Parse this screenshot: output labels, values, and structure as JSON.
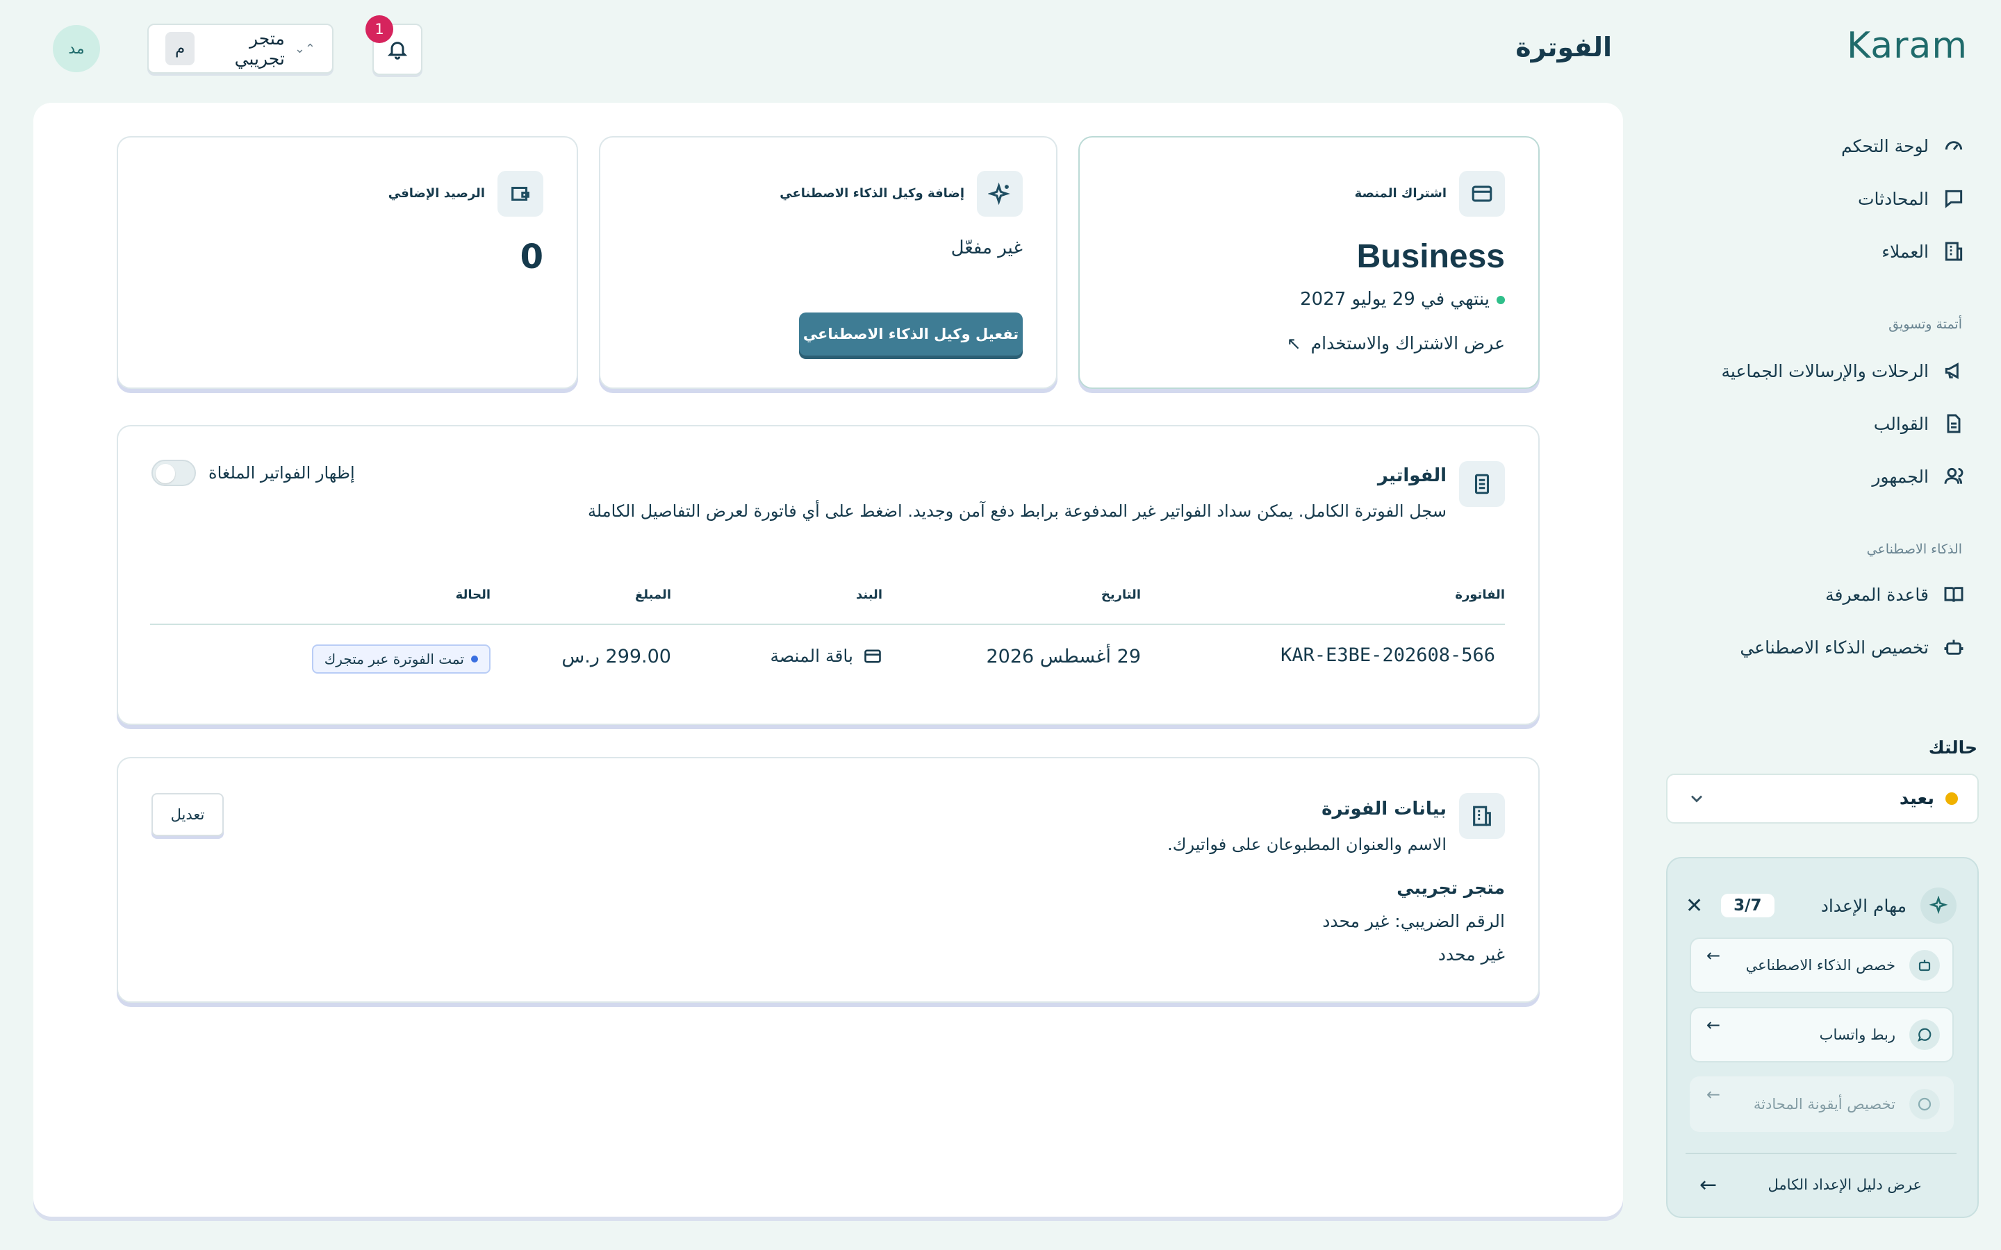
{
  "app": {
    "logo": "Karam",
    "page_title": "الفوترة"
  },
  "sidebar": {
    "items_main": [
      {
        "label": "لوحة التحكم",
        "icon": "gauge-icon"
      },
      {
        "label": "المحادثات",
        "icon": "chat-icon"
      },
      {
        "label": "العملاء",
        "icon": "building-icon"
      }
    ],
    "section_marketing": "أتمتة وتسويق",
    "items_marketing": [
      {
        "label": "الرحلات والإرسالات الجماعية",
        "icon": "megaphone-icon"
      },
      {
        "label": "القوالب",
        "icon": "document-icon"
      },
      {
        "label": "الجمهور",
        "icon": "users-icon"
      }
    ],
    "section_ai": "الذكاء الاصطناعي",
    "items_ai": [
      {
        "label": "قاعدة المعرفة",
        "icon": "book-icon"
      },
      {
        "label": "تخصيص الذكاء الاصطناعي",
        "icon": "bot-icon"
      }
    ],
    "status_label": "حالتك",
    "status_value": "بعيد",
    "status_color": "#f0b100"
  },
  "onboarding": {
    "title": "مهام الإعداد",
    "progress": "3/7",
    "tasks": [
      {
        "label": "خصص الذكاء الاصطناعي",
        "icon": "bot-icon"
      },
      {
        "label": "ربط واتساب",
        "icon": "chat-icon"
      },
      {
        "label": "تخصيص أيقونة المحادثة",
        "icon": "palette-icon"
      }
    ],
    "footer_link": "عرض دليل الإعداد الكامل"
  },
  "header": {
    "avatar_initials": "مد",
    "store_name": "متجر تجريبي",
    "store_initial": "م",
    "notifications_count": "1"
  },
  "cards": {
    "subscription": {
      "label": "اشتراك المنصة",
      "plan": "Business",
      "expiry": "ينتهي في 29 يوليو 2027",
      "link": "عرض الاشتراك والاستخدام"
    },
    "ai_agent": {
      "label": "إضافة وكيل الذكاء الاصطناعي",
      "status": "غير مفعّل",
      "button": "تفعيل وكيل الذكاء الاصطناعي"
    },
    "balance": {
      "label": "الرصيد الإضافي",
      "value": "0"
    }
  },
  "invoices": {
    "title": "الفواتير",
    "description": "سجل الفوترة الكامل. يمكن سداد الفواتير غير المدفوعة برابط دفع آمن وجديد. اضغط على أي فاتورة لعرض التفاصيل الكاملة",
    "toggle_label": "إظهار الفواتير الملغاة",
    "columns": [
      "الفاتورة",
      "التاريخ",
      "البند",
      "المبلغ",
      "الحالة"
    ],
    "rows": [
      {
        "invoice": "KAR-E3BE-202608-566",
        "date": "29 أغسطس 2026",
        "item": "باقة المنصة",
        "amount": "299.00 ر.س",
        "status": "تمت الفوترة عبر متجرك"
      }
    ]
  },
  "billing_info": {
    "title": "بيانات الفوترة",
    "description": "الاسم والعنوان المطبوعان على فواتيرك.",
    "edit_button": "تعديل",
    "name": "متجر تجريبي",
    "tax": "الرقم الضريبي: غير محدد",
    "address": "غير محدد"
  }
}
